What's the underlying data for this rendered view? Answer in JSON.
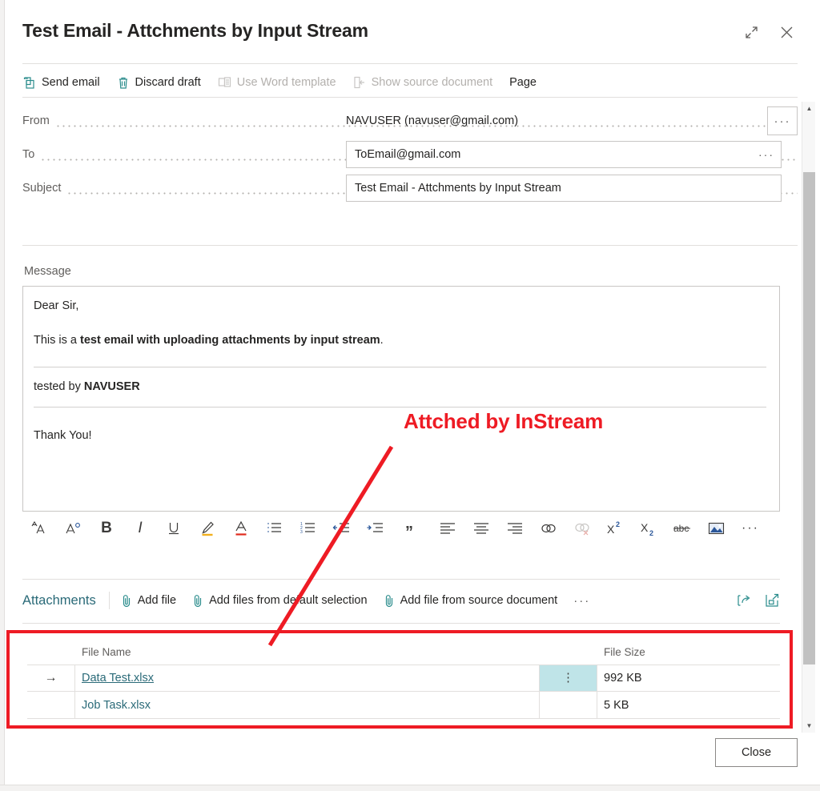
{
  "window": {
    "title": "Test Email - Attchments by Input Stream",
    "expand_icon": "expand-icon",
    "close_icon": "close-icon"
  },
  "command_bar": {
    "items": [
      {
        "label": "Send email",
        "icon": "send-email-icon",
        "disabled": false
      },
      {
        "label": "Discard draft",
        "icon": "trash-icon",
        "disabled": false
      },
      {
        "label": "Use Word template",
        "icon": "word-document-icon",
        "disabled": true
      },
      {
        "label": "Show source document",
        "icon": "source-document-icon",
        "disabled": true
      },
      {
        "label": "Page",
        "icon": "",
        "disabled": false
      }
    ]
  },
  "fields": [
    {
      "label": "From",
      "value": "NAVUSER (navuser@gmail.com)",
      "type": "plain",
      "dots": "···"
    },
    {
      "label": "To",
      "value": "ToEmail@gmail.com",
      "type": "input",
      "dots": "···"
    },
    {
      "label": "Subject",
      "value": "Test Email - Attchments by Input Stream",
      "type": "input",
      "dots": ""
    }
  ],
  "message": {
    "label": "Message",
    "greeting": "Dear Sir,",
    "line_prefix": "This is a ",
    "line_bold": "test email with uploading attachments by input stream",
    "line_suffix": ".",
    "tested_prefix": "tested by ",
    "tested_bold": "NAVUSER",
    "thanks": "Thank You!"
  },
  "editor_toolbar": {
    "items": [
      {
        "name": "font-grow-icon",
        "glyph": "Aᴀ"
      },
      {
        "name": "font-shrink-icon",
        "glyph": "A°"
      },
      {
        "name": "bold-icon",
        "glyph": "B"
      },
      {
        "name": "italic-icon",
        "glyph": "I"
      },
      {
        "name": "underline-icon",
        "glyph": "U"
      },
      {
        "name": "highlight-icon",
        "glyph": "✎"
      },
      {
        "name": "font-color-icon",
        "glyph": "A"
      },
      {
        "name": "bulleted-list-icon",
        "glyph": "☰"
      },
      {
        "name": "numbered-list-icon",
        "glyph": "☰"
      },
      {
        "name": "decrease-indent-icon",
        "glyph": "←"
      },
      {
        "name": "increase-indent-icon",
        "glyph": "→"
      },
      {
        "name": "blockquote-icon",
        "glyph": "”"
      },
      {
        "name": "align-left-icon",
        "glyph": "☰"
      },
      {
        "name": "align-center-icon",
        "glyph": "☰"
      },
      {
        "name": "align-right-icon",
        "glyph": "☰"
      },
      {
        "name": "insert-link-icon",
        "glyph": "⚭"
      },
      {
        "name": "remove-link-icon",
        "glyph": "⚭"
      },
      {
        "name": "superscript-icon",
        "glyph": "X²"
      },
      {
        "name": "subscript-icon",
        "glyph": "X₂"
      },
      {
        "name": "strikethrough-icon",
        "glyph": "abc"
      },
      {
        "name": "insert-image-icon",
        "glyph": "Ὓc"
      },
      {
        "name": "more-options-icon",
        "glyph": "···"
      }
    ]
  },
  "attachments": {
    "title": "Attachments",
    "commands": [
      {
        "label": "Add file",
        "icon": "paperclip-icon"
      },
      {
        "label": "Add files from default selection",
        "icon": "paperclip-icon"
      },
      {
        "label": "Add file from source document",
        "icon": "paperclip-icon"
      }
    ],
    "more_label": "···",
    "share_icon": "share-icon",
    "open-in-new-icon": "open-in-new-window-icon",
    "columns": [
      "File Name",
      "File Size"
    ],
    "rows": [
      {
        "selected": true,
        "indicator": "→",
        "file_name": "Data Test.xlsx",
        "file_size": "992 KB",
        "kebab": "⋮"
      },
      {
        "selected": false,
        "indicator": "",
        "file_name": "Job Task.xlsx",
        "file_size": "5 KB",
        "kebab": "⋮"
      }
    ]
  },
  "footer": {
    "close_label": "Close"
  },
  "annotation": {
    "text": "Attched by InStream",
    "color": "#ee1b24"
  },
  "scrollbar": {
    "up": "▲",
    "down": "▼"
  }
}
